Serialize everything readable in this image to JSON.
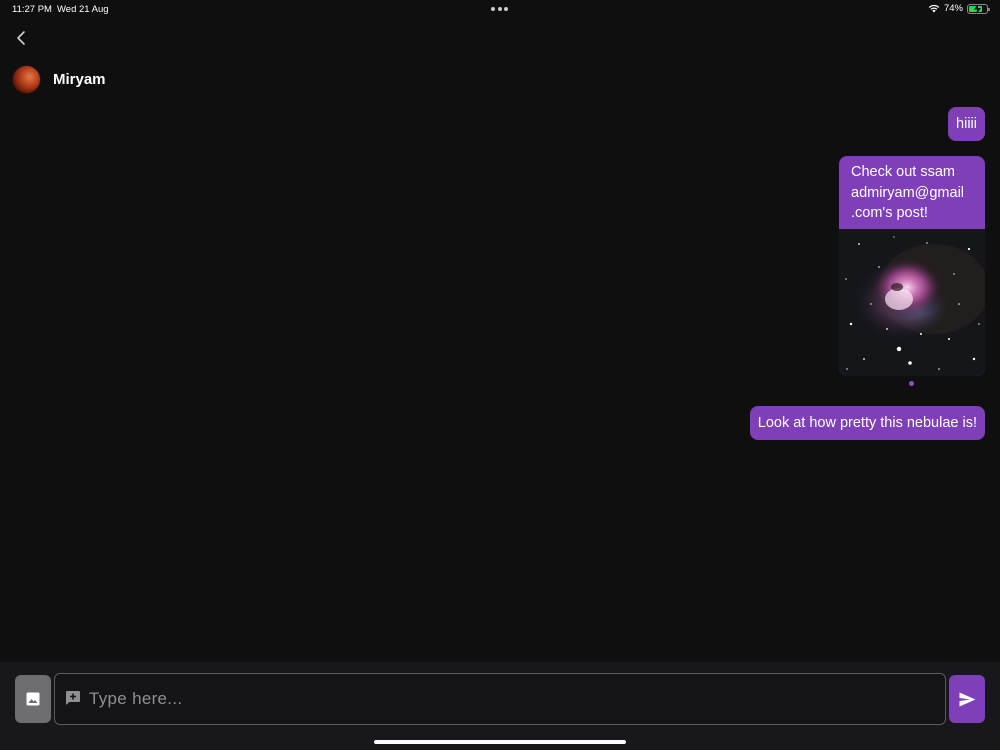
{
  "status_bar": {
    "time": "11:27 PM",
    "date": "Wed 21 Aug",
    "battery_text": "74%",
    "battery_level": 0.74,
    "battery_color": "#30d158",
    "icons": [
      "wifi-icon",
      "battery-icon",
      "charging-bolt-icon",
      "multitasking-dots-icon"
    ]
  },
  "header": {
    "back_icon": "chevron-left-icon",
    "contact_name": "Miryam"
  },
  "messages": [
    {
      "text": "hiiii",
      "from": "me"
    },
    {
      "text": "Check out ssam admiryam@gmail.com's post!",
      "lines": [
        "Check out ssam",
        "admiryam@gmail",
        ".com's post!"
      ],
      "attachment": "nebula-photo",
      "from": "me"
    },
    {
      "text": "Look at how pretty this nebulae is!",
      "from": "me"
    }
  ],
  "composer": {
    "placeholder": "Type here...",
    "image_icon": "image-icon",
    "add_icon": "add-comment-icon",
    "send_icon": "send-icon"
  },
  "colors": {
    "background": "#0f0f10",
    "bubble": "#7f3fb8",
    "composer_bar": "#18171b",
    "image_button": "#6e6e70"
  }
}
